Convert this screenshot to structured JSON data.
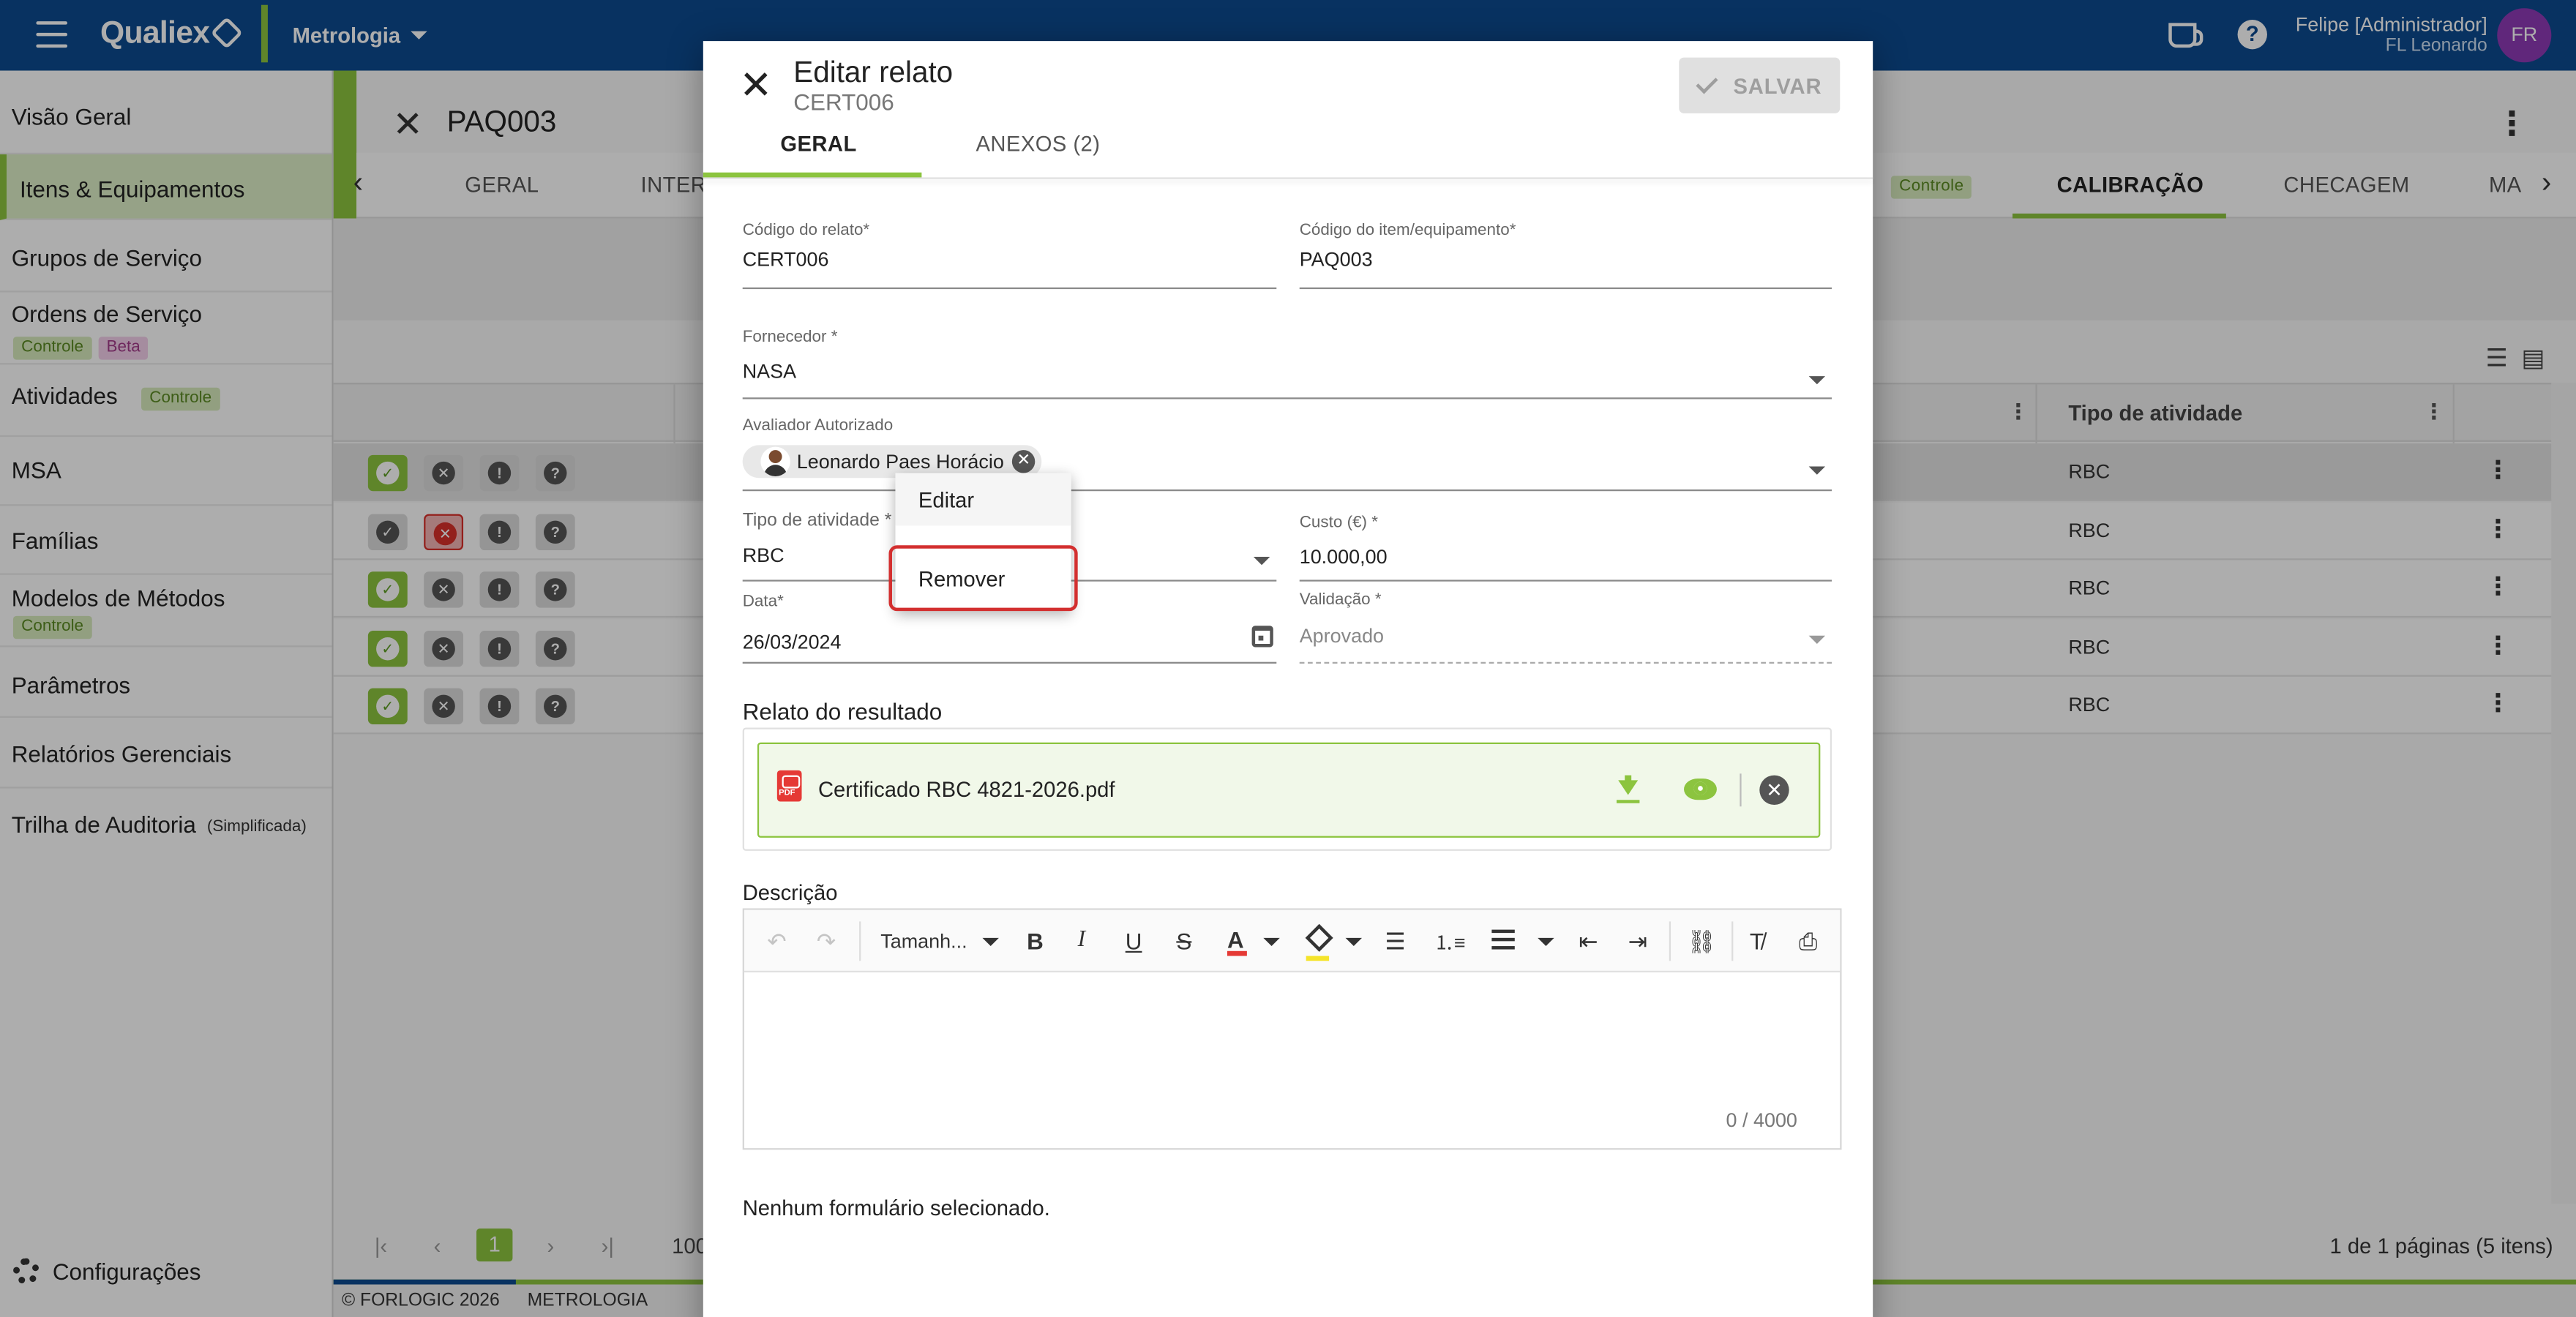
{
  "appbar": {
    "brand": "Qualiex",
    "module": "Metrologia",
    "user_name": "Felipe [Administrador]",
    "user_company": "FL Leonardo",
    "avatar_initials": "FR",
    "colors": {
      "primary": "#0d4a8f",
      "accent": "#8cc43f",
      "avatar": "#8e3ab5"
    }
  },
  "sidebar": {
    "items": [
      {
        "label": "Visão Geral"
      },
      {
        "label": "Itens & Equipamentos",
        "active": true
      },
      {
        "label": "Grupos de Serviço"
      },
      {
        "label": "Ordens de Serviço",
        "badges": [
          "Controle",
          "Beta"
        ]
      },
      {
        "label": "Atividades",
        "badges": [
          "Controle"
        ]
      },
      {
        "label": "MSA"
      },
      {
        "label": "Famílias"
      },
      {
        "label": "Modelos de Métodos",
        "badges": [
          "Controle"
        ]
      },
      {
        "label": "Parâmetros"
      },
      {
        "label": "Relatórios Gerenciais"
      },
      {
        "label": "Trilha de Auditoria",
        "suffix": "(Simplificada)"
      }
    ],
    "config_label": "Configurações"
  },
  "main": {
    "page_title": "PAQ003",
    "tabs": [
      {
        "label": "GERAL"
      },
      {
        "label": "INTERV"
      },
      {
        "label": "Controle",
        "is_badge": true
      },
      {
        "label": "CALIBRAÇÃO",
        "active": true
      },
      {
        "label": "CHECAGEM"
      },
      {
        "label": "MA"
      }
    ],
    "table": {
      "columns": [
        "Tipo de atividade"
      ],
      "rows": [
        {
          "status": "ok",
          "tipo": "RBC",
          "selected": true
        },
        {
          "status": "bad",
          "tipo": "RBC"
        },
        {
          "status": "ok",
          "tipo": "RBC"
        },
        {
          "status": "ok",
          "tipo": "RBC"
        },
        {
          "status": "ok",
          "tipo": "RBC"
        }
      ]
    },
    "pager": {
      "current_page": "1",
      "page_size": "100",
      "info": "1 de 1 páginas (5 itens)"
    },
    "footer": {
      "copyright": "© FORLOGIC 2026",
      "module": "METROLOGIA"
    }
  },
  "dialog": {
    "title": "Editar relato",
    "subtitle": "CERT006",
    "save_label": "SALVAR",
    "tabs": [
      {
        "label": "GERAL",
        "active": true
      },
      {
        "label": "ANEXOS (2)"
      }
    ],
    "fields": {
      "codigo_relato": {
        "label": "Código do relato*",
        "value": "CERT006"
      },
      "codigo_item": {
        "label": "Código do item/equipamento*",
        "value": "PAQ003"
      },
      "fornecedor": {
        "label": "Fornecedor *",
        "value": "NASA"
      },
      "avaliador": {
        "label": "Avaliador Autorizado",
        "chip": "Leonardo Paes Horácio"
      },
      "tipo_atividade": {
        "label": "Tipo de atividade *",
        "value": "RBC"
      },
      "custo": {
        "label": "Custo (€) *",
        "value": "10.000,00"
      },
      "data": {
        "label": "Data*",
        "value": "26/03/2024"
      },
      "validacao": {
        "label": "Validação *",
        "value": "Aprovado"
      }
    },
    "relato_title": "Relato do resultado",
    "attachment_name": "Certificado RBC 4821-2026.pdf",
    "descricao_title": "Descrição",
    "editor": {
      "font_size_label": "Tamanh...",
      "counter": "0 / 4000"
    },
    "no_form_text": "Nenhum formulário selecionado."
  },
  "context_menu": {
    "items": [
      {
        "label": "Editar"
      },
      {
        "label": "Remover",
        "highlighted": true
      }
    ],
    "highlight_color": "#d32f2f"
  }
}
